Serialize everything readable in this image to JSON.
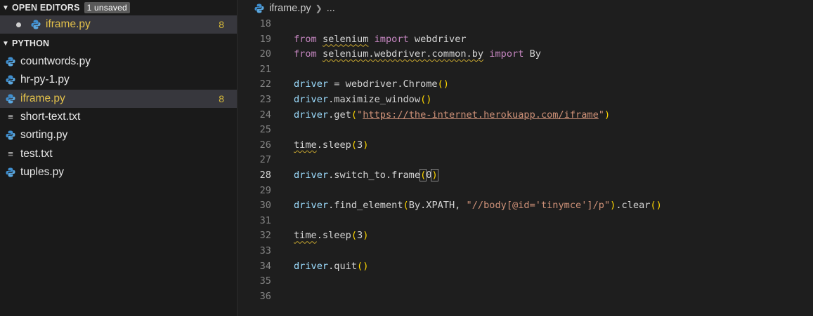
{
  "sidebar": {
    "open_editors": {
      "title": "OPEN EDITORS",
      "badge": "1 unsaved",
      "items": [
        {
          "label": "iframe.py",
          "count": "8",
          "icon": "python-icon"
        }
      ]
    },
    "folder": {
      "title": "PYTHON",
      "items": [
        {
          "label": "countwords.py",
          "icon": "python-icon"
        },
        {
          "label": "hr-py-1.py",
          "icon": "python-icon"
        },
        {
          "label": "iframe.py",
          "icon": "python-icon",
          "count": "8"
        },
        {
          "label": "short-text.txt",
          "icon": "text-file-icon"
        },
        {
          "label": "sorting.py",
          "icon": "python-icon"
        },
        {
          "label": "test.txt",
          "icon": "text-file-icon"
        },
        {
          "label": "tuples.py",
          "icon": "python-icon"
        }
      ]
    }
  },
  "editor": {
    "breadcrumb": {
      "file": "iframe.py",
      "rest": "..."
    },
    "lines": [
      {
        "n": "18",
        "tokens": []
      },
      {
        "n": "19",
        "tokens": [
          {
            "t": "from",
            "c": "kw"
          },
          {
            "t": " ",
            "c": "plain"
          },
          {
            "t": "selenium",
            "c": "plain",
            "sq": true
          },
          {
            "t": " ",
            "c": "plain"
          },
          {
            "t": "import",
            "c": "kw"
          },
          {
            "t": " webdriver",
            "c": "plain"
          }
        ]
      },
      {
        "n": "20",
        "tokens": [
          {
            "t": "from",
            "c": "kw"
          },
          {
            "t": " ",
            "c": "plain"
          },
          {
            "t": "selenium.webdriver.common.by",
            "c": "plain",
            "sq": true
          },
          {
            "t": " ",
            "c": "plain"
          },
          {
            "t": "import",
            "c": "kw"
          },
          {
            "t": " By",
            "c": "plain"
          }
        ]
      },
      {
        "n": "21",
        "tokens": []
      },
      {
        "n": "22",
        "tokens": [
          {
            "t": "driver",
            "c": "var"
          },
          {
            "t": " = webdriver.Chrome",
            "c": "plain"
          },
          {
            "t": "()",
            "c": "br"
          }
        ]
      },
      {
        "n": "23",
        "tokens": [
          {
            "t": "driver",
            "c": "var"
          },
          {
            "t": ".maximize_window",
            "c": "plain"
          },
          {
            "t": "()",
            "c": "br"
          }
        ]
      },
      {
        "n": "24",
        "tokens": [
          {
            "t": "driver",
            "c": "var"
          },
          {
            "t": ".get",
            "c": "plain"
          },
          {
            "t": "(",
            "c": "br"
          },
          {
            "t": "\"",
            "c": "str"
          },
          {
            "t": "https://the-internet.herokuapp.com/iframe",
            "c": "str",
            "url": true
          },
          {
            "t": "\"",
            "c": "str"
          },
          {
            "t": ")",
            "c": "br"
          }
        ]
      },
      {
        "n": "25",
        "tokens": []
      },
      {
        "n": "26",
        "tokens": [
          {
            "t": "time",
            "c": "plain",
            "sq": true
          },
          {
            "t": ".sleep",
            "c": "plain"
          },
          {
            "t": "(",
            "c": "br"
          },
          {
            "t": "3",
            "c": "plain"
          },
          {
            "t": ")",
            "c": "br"
          }
        ]
      },
      {
        "n": "27",
        "tokens": []
      },
      {
        "n": "28",
        "tokens": [
          {
            "t": "driver",
            "c": "var"
          },
          {
            "t": ".switch_to.frame",
            "c": "plain"
          },
          {
            "t": "(",
            "c": "br",
            "box": true
          },
          {
            "t": "0",
            "c": "plain"
          },
          {
            "t": "CURSOR",
            "c": "cursor"
          },
          {
            "t": ")",
            "c": "br",
            "box": true
          }
        ],
        "current": true
      },
      {
        "n": "29",
        "tokens": []
      },
      {
        "n": "30",
        "tokens": [
          {
            "t": "driver",
            "c": "var"
          },
          {
            "t": ".find_element",
            "c": "plain"
          },
          {
            "t": "(",
            "c": "br"
          },
          {
            "t": "By.XPATH, ",
            "c": "plain"
          },
          {
            "t": "\"//body[@id='tinymce']/p\"",
            "c": "str"
          },
          {
            "t": ")",
            "c": "br"
          },
          {
            "t": ".clear",
            "c": "plain"
          },
          {
            "t": "()",
            "c": "br"
          }
        ]
      },
      {
        "n": "31",
        "tokens": []
      },
      {
        "n": "32",
        "tokens": [
          {
            "t": "time",
            "c": "plain",
            "sq": true
          },
          {
            "t": ".sleep",
            "c": "plain"
          },
          {
            "t": "(",
            "c": "br"
          },
          {
            "t": "3",
            "c": "plain"
          },
          {
            "t": ")",
            "c": "br"
          }
        ]
      },
      {
        "n": "33",
        "tokens": []
      },
      {
        "n": "34",
        "tokens": [
          {
            "t": "driver",
            "c": "var"
          },
          {
            "t": ".quit",
            "c": "plain"
          },
          {
            "t": "()",
            "c": "br"
          }
        ]
      },
      {
        "n": "35",
        "tokens": []
      },
      {
        "n": "36",
        "tokens": []
      }
    ]
  }
}
